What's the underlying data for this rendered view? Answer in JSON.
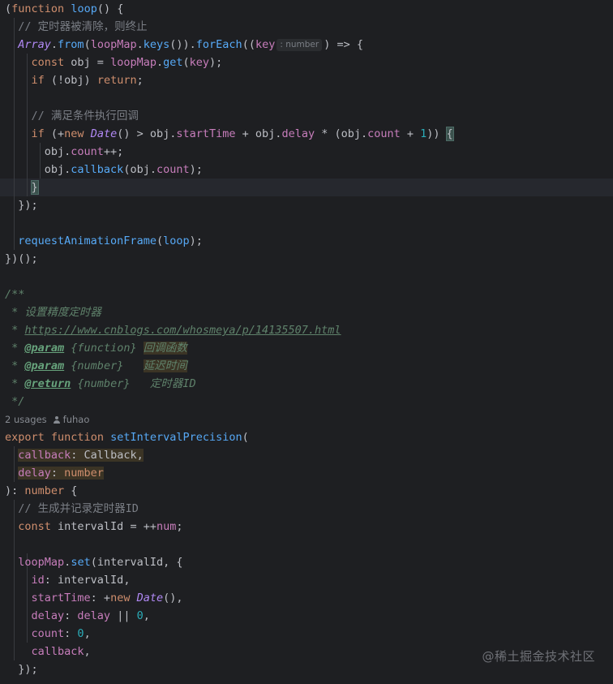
{
  "editor": {
    "lines": [
      [
        {
          "t": "(",
          "c": "ps"
        },
        {
          "t": "function",
          "c": "kw"
        },
        {
          "t": " "
        },
        {
          "t": "loop",
          "c": "fn"
        },
        {
          "t": "() {"
        }
      ],
      [
        {
          "t": "  "
        },
        {
          "t": "// 定时器被清除，则终止",
          "c": "cm"
        }
      ],
      [
        {
          "t": "  "
        },
        {
          "t": "Array",
          "c": "cls"
        },
        {
          "t": "."
        },
        {
          "t": "from",
          "c": "fnc"
        },
        {
          "t": "("
        },
        {
          "t": "loopMap",
          "c": "var"
        },
        {
          "t": "."
        },
        {
          "t": "keys",
          "c": "fnc"
        },
        {
          "t": "())."
        },
        {
          "t": "forEach",
          "c": "fnc"
        },
        {
          "t": "(("
        },
        {
          "t": "key",
          "c": "var"
        },
        {
          "hint": ": number"
        },
        {
          "t": ") => {"
        }
      ],
      [
        {
          "t": "    "
        },
        {
          "t": "const",
          "c": "kw"
        },
        {
          "t": " obj = "
        },
        {
          "t": "loopMap",
          "c": "var"
        },
        {
          "t": "."
        },
        {
          "t": "get",
          "c": "fnc"
        },
        {
          "t": "("
        },
        {
          "t": "key",
          "c": "var"
        },
        {
          "t": ");"
        }
      ],
      [
        {
          "t": "    "
        },
        {
          "t": "if",
          "c": "kw"
        },
        {
          "t": " (!obj) "
        },
        {
          "t": "return",
          "c": "kw"
        },
        {
          "t": ";"
        }
      ],
      [],
      [
        {
          "t": "    "
        },
        {
          "t": "// 满足条件执行回调",
          "c": "cm"
        }
      ],
      [
        {
          "t": "    "
        },
        {
          "t": "if",
          "c": "kw"
        },
        {
          "t": " (+"
        },
        {
          "t": "new",
          "c": "kw"
        },
        {
          "t": " "
        },
        {
          "t": "Date",
          "c": "cls"
        },
        {
          "t": "() > obj."
        },
        {
          "t": "startTime",
          "c": "var"
        },
        {
          "t": " + obj."
        },
        {
          "t": "delay",
          "c": "var"
        },
        {
          "t": " * (obj."
        },
        {
          "t": "count",
          "c": "var"
        },
        {
          "t": " + "
        },
        {
          "t": "1",
          "c": "num"
        },
        {
          "t": ")) "
        },
        {
          "t": "{",
          "c": "brk"
        }
      ],
      [
        {
          "t": "      obj."
        },
        {
          "t": "count",
          "c": "var"
        },
        {
          "t": "++;"
        }
      ],
      [
        {
          "t": "      obj."
        },
        {
          "t": "callback",
          "c": "fnc"
        },
        {
          "t": "(obj."
        },
        {
          "t": "count",
          "c": "var"
        },
        {
          "t": ");"
        }
      ],
      [
        {
          "t": "    "
        },
        {
          "t": "}",
          "c": "brk"
        }
      ],
      [
        {
          "t": "  });"
        }
      ],
      [],
      [
        {
          "t": "  "
        },
        {
          "t": "requestAnimationFrame",
          "c": "fnc"
        },
        {
          "t": "("
        },
        {
          "t": "loop",
          "c": "fn"
        },
        {
          "t": ");"
        }
      ],
      [
        {
          "t": "})();"
        }
      ],
      [],
      [
        {
          "t": "/**",
          "c": "doc"
        }
      ],
      [
        {
          "t": " * 设置精度定时器",
          "c": "doc"
        }
      ],
      [
        {
          "t": " * ",
          "c": "doc"
        },
        {
          "t": "https://www.cnblogs.com/whosmeya/p/14135507.html",
          "c": "link"
        }
      ],
      [
        {
          "t": " * ",
          "c": "doc"
        },
        {
          "t": "@param",
          "c": "doctag"
        },
        {
          "t": " {function} ",
          "c": "doctype"
        },
        {
          "t": "回调函数",
          "c": "doc hl"
        }
      ],
      [
        {
          "t": " * ",
          "c": "doc"
        },
        {
          "t": "@param",
          "c": "doctag"
        },
        {
          "t": " {number}   ",
          "c": "doctype"
        },
        {
          "t": "延迟时间",
          "c": "doc hl"
        }
      ],
      [
        {
          "t": " * ",
          "c": "doc"
        },
        {
          "t": "@return",
          "c": "doctag"
        },
        {
          "t": " {number}   ",
          "c": "doctype"
        },
        {
          "t": "定时器ID",
          "c": "doc"
        }
      ],
      [
        {
          "t": " */",
          "c": "doc"
        }
      ],
      {
        "meta": true
      },
      [
        {
          "t": "export",
          "c": "kw"
        },
        {
          "t": " "
        },
        {
          "t": "function",
          "c": "kw"
        },
        {
          "t": " "
        },
        {
          "t": "setIntervalPrecision",
          "c": "fn"
        },
        {
          "t": "("
        }
      ],
      [
        {
          "t": "  "
        },
        {
          "t": "callback",
          "c": "var hl"
        },
        {
          "t": ": Callback,",
          "c": "hl"
        }
      ],
      [
        {
          "t": "  "
        },
        {
          "t": "delay",
          "c": "var hl"
        },
        {
          "t": ": ",
          "c": "hl"
        },
        {
          "t": "number",
          "c": "kw hl"
        }
      ],
      [
        {
          "t": "): "
        },
        {
          "t": "number",
          "c": "kw"
        },
        {
          "t": " {"
        }
      ],
      [
        {
          "t": "  "
        },
        {
          "t": "// 生成并记录定时器ID",
          "c": "cm"
        }
      ],
      [
        {
          "t": "  "
        },
        {
          "t": "const",
          "c": "kw"
        },
        {
          "t": " intervalId = ++"
        },
        {
          "t": "num",
          "c": "var"
        },
        {
          "t": ";"
        }
      ],
      [],
      [
        {
          "t": "  "
        },
        {
          "t": "loopMap",
          "c": "var"
        },
        {
          "t": "."
        },
        {
          "t": "set",
          "c": "fnc"
        },
        {
          "t": "(intervalId, {"
        }
      ],
      [
        {
          "t": "    "
        },
        {
          "t": "id",
          "c": "var"
        },
        {
          "t": ": intervalId,"
        }
      ],
      [
        {
          "t": "    "
        },
        {
          "t": "startTime",
          "c": "var"
        },
        {
          "t": ": +"
        },
        {
          "t": "new",
          "c": "kw"
        },
        {
          "t": " "
        },
        {
          "t": "Date",
          "c": "cls"
        },
        {
          "t": "(),"
        }
      ],
      [
        {
          "t": "    "
        },
        {
          "t": "delay",
          "c": "var"
        },
        {
          "t": ": "
        },
        {
          "t": "delay",
          "c": "var"
        },
        {
          "t": " || "
        },
        {
          "t": "0",
          "c": "num"
        },
        {
          "t": ","
        }
      ],
      [
        {
          "t": "    "
        },
        {
          "t": "count",
          "c": "var"
        },
        {
          "t": ": "
        },
        {
          "t": "0",
          "c": "num"
        },
        {
          "t": ","
        }
      ],
      [
        {
          "t": "    "
        },
        {
          "t": "callback",
          "c": "var"
        },
        {
          "t": ","
        }
      ],
      [
        {
          "t": "  });"
        }
      ]
    ],
    "usage": {
      "count_label": "2 usages",
      "author": "fuhao",
      "author_icon": "person-icon"
    },
    "current_line_index": 10
  },
  "watermark": "@稀土掘金技术社区"
}
